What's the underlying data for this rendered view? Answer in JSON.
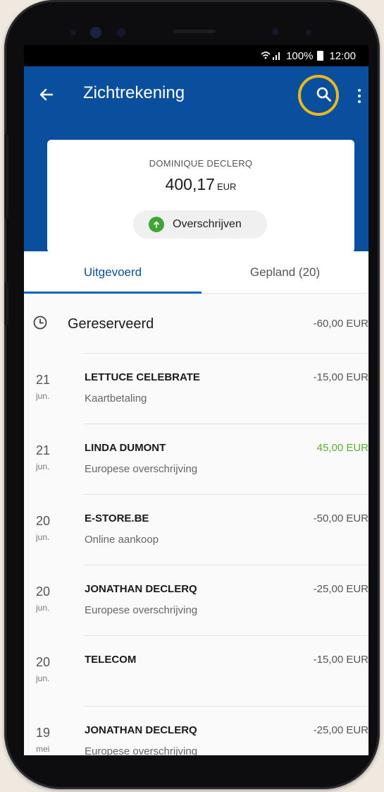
{
  "status_bar": {
    "battery": "100%",
    "time": "12:00",
    "signal": "📶"
  },
  "app_bar": {
    "title": "Zichtrekening"
  },
  "account_card": {
    "holder": "DOMINIQUE DECLERQ",
    "balance": "400,17",
    "currency": "EUR",
    "transfer_label": "Overschrijven"
  },
  "tabs": [
    {
      "label": "Uitgevoerd",
      "active": true
    },
    {
      "label": "Gepland (20)",
      "active": false
    }
  ],
  "reserved": {
    "label": "Gereserveerd",
    "amount": "-60,00 EUR"
  },
  "transactions": [
    {
      "day": "21",
      "month": "jun.",
      "merchant": "LETTUCE CELEBRATE",
      "type": "Kaartbetaling",
      "amount": "-15,00 EUR",
      "positive": false
    },
    {
      "day": "21",
      "month": "jun.",
      "merchant": "LINDA DUMONT",
      "type": "Europese overschrijving",
      "amount": "45,00 EUR",
      "positive": true
    },
    {
      "day": "20",
      "month": "jun.",
      "merchant": "E-STORE.BE",
      "type": "Online aankoop",
      "amount": "-50,00 EUR",
      "positive": false
    },
    {
      "day": "20",
      "month": "jun.",
      "merchant": "JONATHAN DECLERQ",
      "type": "Europese overschrijving",
      "amount": "-25,00 EUR",
      "positive": false
    },
    {
      "day": "20",
      "month": "jun.",
      "merchant": "TELECOM",
      "type": "",
      "amount": "-15,00 EUR",
      "positive": false
    },
    {
      "day": "19",
      "month": "mei",
      "merchant": "JONATHAN DECLERQ",
      "type": "Europese overschrijving",
      "amount": "-25,00 EUR",
      "positive": false
    }
  ],
  "colors": {
    "primary": "#0a4e9e",
    "positive": "#5aae32",
    "highlight": "#e8b81e"
  }
}
